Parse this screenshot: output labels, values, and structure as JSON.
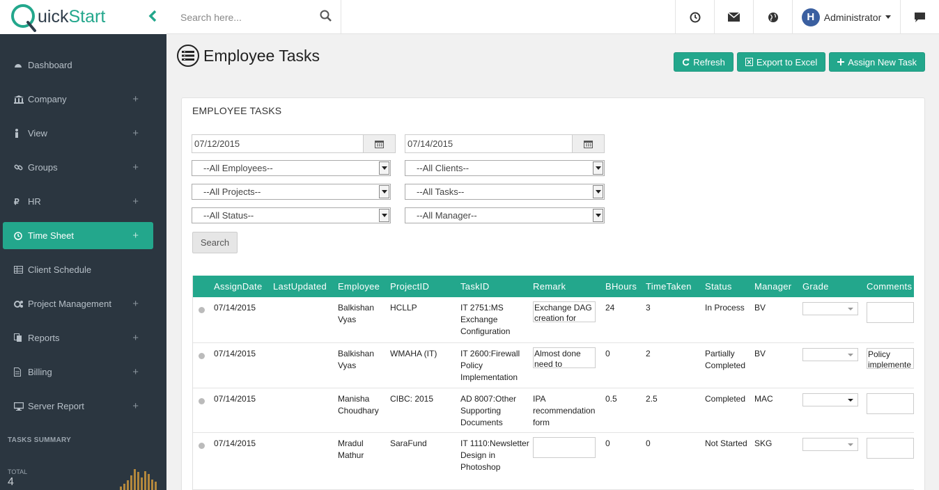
{
  "app": {
    "logo_q": "Q",
    "logo_uick": "uick",
    "logo_start": "Start"
  },
  "topbar": {
    "search_placeholder": "Search here...",
    "user": "Administrator",
    "avatar_letter": "H"
  },
  "sidebar": {
    "items": [
      {
        "label": "Dashboard",
        "icon": "dashboard-icon",
        "expandable": false
      },
      {
        "label": "Company",
        "icon": "bank-icon",
        "expandable": true
      },
      {
        "label": "View",
        "icon": "person-icon",
        "expandable": true
      },
      {
        "label": "Groups",
        "icon": "link-icon",
        "expandable": true
      },
      {
        "label": "HR",
        "icon": "ruble-icon",
        "expandable": true
      },
      {
        "label": "Time Sheet",
        "icon": "clock-icon",
        "expandable": true,
        "active": true
      },
      {
        "label": "Client Schedule",
        "icon": "table-icon",
        "expandable": false
      },
      {
        "label": "Project Management",
        "icon": "gears-icon",
        "expandable": true
      },
      {
        "label": "Reports",
        "icon": "copy-icon",
        "expandable": true
      },
      {
        "label": "Billing",
        "icon": "file-icon",
        "expandable": true
      },
      {
        "label": "Server Report",
        "icon": "desktop-icon",
        "expandable": true
      }
    ],
    "plus": "+",
    "tasks_summary": "TASKS SUMMARY",
    "total_label": "TOTAL",
    "total_value": "4",
    "spark_values": [
      3,
      6,
      9,
      14,
      20,
      17,
      12,
      18,
      15,
      10,
      8
    ]
  },
  "page": {
    "title": "Employee Tasks"
  },
  "actions": {
    "refresh": "Refresh",
    "export": "Export to Excel",
    "assign": "Assign New Task"
  },
  "panel": {
    "title": "EMPLOYEE TASKS",
    "from_date": "07/12/2015",
    "to_date": "07/14/2015",
    "employees": "--All Employees--",
    "clients": "--All Clients--",
    "projects": "--All Projects--",
    "tasks": "--All Tasks--",
    "status": "--All Status--",
    "manager": "--All Manager--",
    "search": "Search"
  },
  "table": {
    "headers": [
      "",
      "AssignDate",
      "LastUpdated",
      "Employee",
      "ProjectID",
      "TaskID",
      "Remark",
      "BHours",
      "TimeTaken",
      "Status",
      "Manager",
      "Grade",
      "Comments"
    ],
    "rows": [
      {
        "assign": "07/14/2015",
        "updated": "",
        "employee": "Balkishan Vyas",
        "project": "HCLLP",
        "task": "IT 2751:MS Exchange Configuration",
        "remark": "Exchange DAG creation for",
        "remark_type": "box",
        "bhours": "24",
        "taken": "3",
        "status": "In Process",
        "manager": "BV",
        "grade_dark": false,
        "comment": ""
      },
      {
        "assign": "07/14/2015",
        "updated": "",
        "employee": "Balkishan Vyas",
        "project": "WMAHA (IT)",
        "task": "IT 2600:Firewall Policy Implementation",
        "remark": "Almost done need to",
        "remark_type": "box",
        "bhours": "0",
        "taken": "2",
        "status": "Partially Completed",
        "manager": "BV",
        "grade_dark": false,
        "comment": "Policy implemente"
      },
      {
        "assign": "07/14/2015",
        "updated": "",
        "employee": "Manisha Choudhary",
        "project": "CIBC: 2015",
        "task": "AD 8007:Other Supporting Documents",
        "remark": "IPA recommendation form",
        "remark_type": "text",
        "bhours": "0.5",
        "taken": "2.5",
        "status": "Completed",
        "manager": "MAC",
        "grade_dark": true,
        "comment": ""
      },
      {
        "assign": "07/14/2015",
        "updated": "",
        "employee": "Mradul Mathur",
        "project": "SaraFund",
        "task": "IT 1110:Newsletter Design in Photoshop",
        "remark": "",
        "remark_type": "box",
        "bhours": "0",
        "taken": "0",
        "status": "Not Started",
        "manager": "SKG",
        "grade_dark": false,
        "comment": ""
      }
    ]
  }
}
